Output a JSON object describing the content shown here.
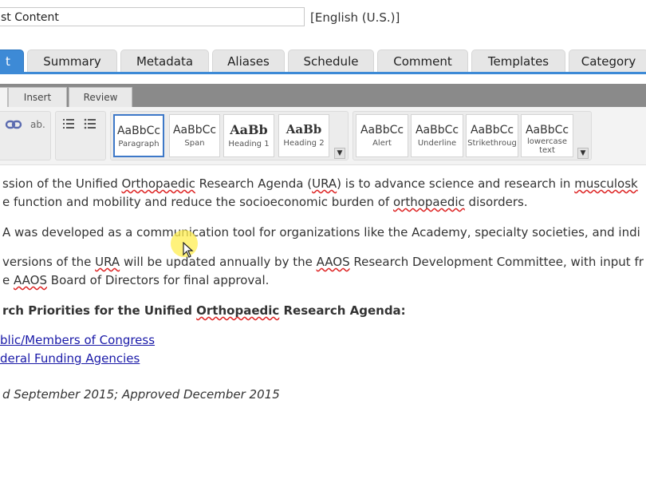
{
  "title_field": {
    "value": "st Content"
  },
  "language": "[English (U.S.)]",
  "tabs": [
    {
      "label": "t"
    },
    {
      "label": "Summary"
    },
    {
      "label": "Metadata"
    },
    {
      "label": "Aliases"
    },
    {
      "label": "Schedule"
    },
    {
      "label": "Comment"
    },
    {
      "label": "Templates"
    },
    {
      "label": "Category"
    }
  ],
  "ribbon": {
    "tabs": [
      {
        "label": "Insert"
      },
      {
        "label": "Review"
      }
    ],
    "text_tools": {
      "abbr": "ab."
    },
    "styles": [
      {
        "sample": "AaBbCc",
        "label": "Paragraph"
      },
      {
        "sample": "AaBbCc",
        "label": "Span"
      },
      {
        "sample": "AaBb",
        "label": "Heading 1"
      },
      {
        "sample": "AaBb",
        "label": "Heading 2"
      }
    ],
    "styles2": [
      {
        "sample": "AaBbCc",
        "label": "Alert"
      },
      {
        "sample": "AaBbCc",
        "label": "Underline"
      },
      {
        "sample": "AaBbCc",
        "label": "Strikethroug"
      },
      {
        "sample": "AaBbCc",
        "label": "lowercase text"
      }
    ]
  },
  "content": {
    "p1_line1": {
      "a": "ssion of the Unified ",
      "b": "Orthopaedic",
      "c": " Research Agenda (",
      "d": "URA",
      "e": ") is to advance science and research in ",
      "f": "musculosk"
    },
    "p1_line2": {
      "a": "e function and mobility and reduce the socioeconomic burden of ",
      "b": "orthopaedic",
      "c": " disorders."
    },
    "p2": "A was developed as a communication tool for organizations like the Academy, specialty societies, and indi",
    "p3_line1": {
      "a": "versions of the ",
      "b": "URA",
      "c": " will be updated annually by the ",
      "d": "AAOS",
      "e": " Research Development Committee, with input fr"
    },
    "p3_line2": {
      "a": "e ",
      "b": "AAOS",
      "c": " Board of Directors for final approval."
    },
    "heading": {
      "a": "rch Priorities for the Unified ",
      "b": "Orthopaedic",
      "c": " Research Agenda:"
    },
    "links": [
      "blic/Members of Congress",
      "deral Funding Agencies"
    ],
    "footer": "d September 2015; Approved December 2015"
  }
}
